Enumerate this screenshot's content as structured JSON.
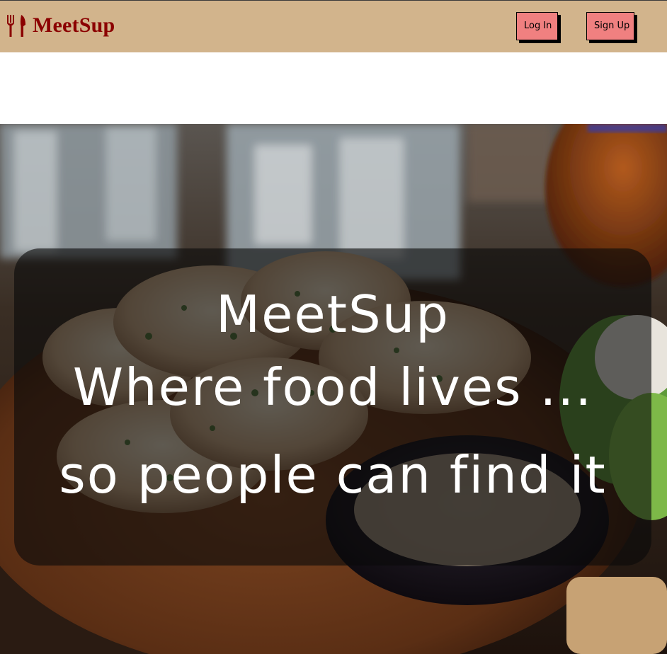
{
  "navbar": {
    "brand": {
      "icon": "fork-knife-icon",
      "name": "MeetSup",
      "color": "#8b0000"
    },
    "login_label": "Log In",
    "signup_label": "Sign Up",
    "background": "#d2b48c",
    "button_color": "#f08080"
  },
  "hero": {
    "image": "food-plate-photo",
    "title": "MeetSup",
    "tagline_line1": "Where food lives ...",
    "tagline_line2": "so people can find it"
  }
}
